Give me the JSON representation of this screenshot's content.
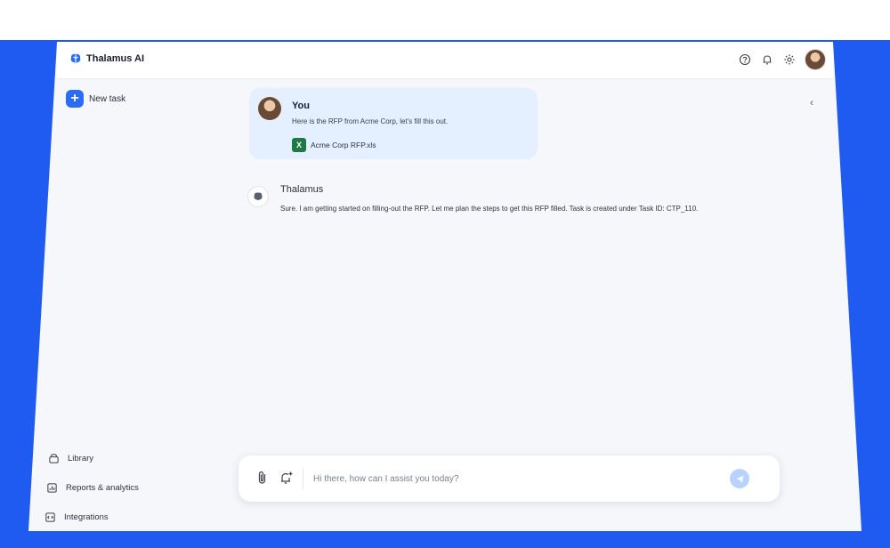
{
  "app": {
    "title": "Thalamus AI"
  },
  "topbar": {
    "icons": [
      "help-circle-icon",
      "bell-icon",
      "gear-icon"
    ],
    "avatar": "user-avatar"
  },
  "sidebar": {
    "new_task_label": "New task",
    "nav_items": [
      {
        "label": "Library",
        "icon": "library-icon"
      },
      {
        "label": "Reports & analytics",
        "icon": "reports-icon"
      },
      {
        "label": "Integrations",
        "icon": "integrations-icon"
      }
    ]
  },
  "conversation": {
    "user_message": {
      "author": "You",
      "text": "Here is the RFP from Acme Corp, let's fill this out.",
      "attachment": {
        "name": "Acme Corp RFP.xls",
        "icon": "excel-file-icon"
      }
    },
    "assistant_message": {
      "author": "Thalamus",
      "text": "Sure. I am getting started on filling-out the RFP. Let me plan the steps to get this RFP filled. Task is created under Task ID: CTP_110."
    }
  },
  "composer": {
    "placeholder": "Hi there, how can I assist you today?",
    "value": ""
  },
  "colors": {
    "background_blue": "#1f5bf0",
    "accent": "#2b6cf5",
    "user_bubble": "#e4efff",
    "send_button": "#b9d3ff"
  }
}
